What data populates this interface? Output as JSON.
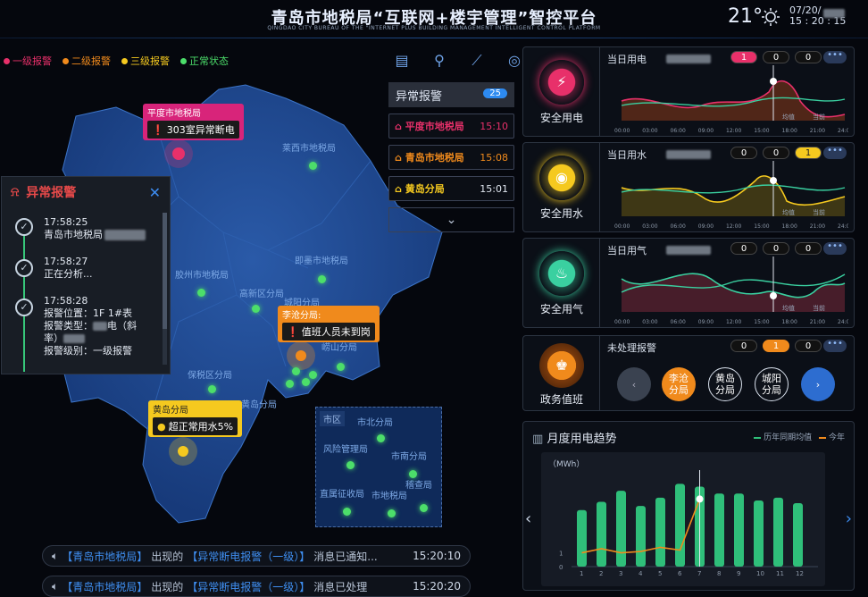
{
  "header": {
    "title": "青岛市地税局“互联网+楼宇管理”智控平台",
    "subtitle": "QINGDAO CITY BUREAU OF THE \"INTERNET PLUS BUILDING MANAGEMENT INTELLIGENT CONTROL PLATFORM",
    "temperature": "21°",
    "date": "07/20/",
    "time": "15 : 20 : 15"
  },
  "legend": [
    {
      "label": "一级报警",
      "color": "#e8306a"
    },
    {
      "label": "二级报警",
      "color": "#f08a1c"
    },
    {
      "label": "三级报警",
      "color": "#f5c91f"
    },
    {
      "label": "正常状态",
      "color": "#4cde6a"
    }
  ],
  "map": {
    "labels": [
      "莱西市地税局",
      "胶州市地税局",
      "即墨市地税局",
      "高新区分局",
      "城阳分局",
      "崂山分局",
      "保税区分局",
      "黄岛分局"
    ],
    "inset_title": "市区",
    "inset_labels": [
      "市北分局",
      "风险管理局",
      "市南分局",
      "稽查局",
      "直属征收局",
      "市地税局"
    ],
    "callouts": [
      {
        "title": "平度市地税局",
        "message": "303室异常断电",
        "level": "一级"
      },
      {
        "title": "李沧分局:",
        "message": "值班人员未到岗",
        "level": "二级"
      },
      {
        "title": "黄岛分局",
        "message": "超正常用水5%",
        "level": "三级"
      }
    ]
  },
  "toolbar": {
    "icons": [
      "chart-icon",
      "person-pin-icon",
      "trend-icon",
      "camera-icon"
    ]
  },
  "abnormal": {
    "title": "异常报警",
    "count": "25",
    "items": [
      {
        "name": "平度市地税局",
        "time": "15:10",
        "color": "#e8306a"
      },
      {
        "name": "青岛市地税局",
        "time": "15:08",
        "color": "#f08a1c"
      },
      {
        "name": "黄岛分局",
        "time": "15:01",
        "color": "#f5c91f"
      }
    ]
  },
  "popup": {
    "title": "异常报警",
    "entries": [
      {
        "time": "17:58:25",
        "text": "青岛市地税局"
      },
      {
        "time": "17:58:27",
        "text": "正在分析..."
      },
      {
        "time": "17:58:28",
        "lines": [
          "报警位置：1F 1#表",
          "报警类型：",
          "电（斜",
          "率）",
          "报警级别：一级报警"
        ]
      }
    ]
  },
  "ticker": [
    {
      "bracket1": "【青岛市地税局】",
      "mid1": "出现的",
      "bracket2": "【异常断电报警（一级）】",
      "tail": "消息已通知...",
      "time": "15:20:10"
    },
    {
      "bracket1": "【青岛市地税局】",
      "mid1": "出现的",
      "bracket2": "【异常断电报警（一级）】",
      "tail": "消息已处理",
      "time": "15:20:20"
    }
  ],
  "cards": [
    {
      "label": "安全用电",
      "title": "当日用电",
      "pills": [
        "1",
        "0",
        "0"
      ],
      "ring_color": "#e8306a",
      "icon": "lightning-icon",
      "xticks": [
        "00:00",
        "03:00",
        "06:00",
        "09:00",
        "12:00",
        "15:00",
        "18:00",
        "21:00",
        "24:00"
      ],
      "legend": [
        "均值",
        "当前"
      ]
    },
    {
      "label": "安全用水",
      "title": "当日用水",
      "pills": [
        "0",
        "0",
        "1"
      ],
      "ring_color": "#f5c91f",
      "icon": "water-drop-icon",
      "xticks": [
        "00:00",
        "03:00",
        "06:00",
        "09:00",
        "12:00",
        "15:00",
        "18:00",
        "21:00",
        "24:00"
      ],
      "legend": [
        "均值",
        "当前"
      ]
    },
    {
      "label": "安全用气",
      "title": "当日用气",
      "pills": [
        "0",
        "0",
        "0"
      ],
      "ring_color": "#3ad0a0",
      "icon": "flame-icon",
      "xticks": [
        "00:00",
        "03:00",
        "06:00",
        "09:00",
        "12:00",
        "15:00",
        "18:00",
        "21:00",
        "24:00"
      ],
      "legend": [
        "均值",
        "当前"
      ]
    }
  ],
  "duty": {
    "label": "政务值班",
    "title": "未处理报警",
    "pills": [
      "0",
      "1",
      "0"
    ],
    "buttons": [
      "李沧\n分局",
      "黄岛\n分局",
      "城阳\n分局"
    ]
  },
  "trend": {
    "title": "月度用电趋势",
    "legend": [
      "历年同期均值",
      "今年"
    ],
    "unit": "（MWh）",
    "more": "•••"
  },
  "chart_data": {
    "type": "bar",
    "title": "月度用电趋势",
    "ylabel": "（MWh）",
    "categories": [
      "1",
      "2",
      "3",
      "4",
      "5",
      "6",
      "7",
      "8",
      "9",
      "10",
      "11",
      "12"
    ],
    "series": [
      {
        "name": "历年同期均值",
        "values": [
          4.1,
          4.7,
          5.5,
          4.4,
          5.0,
          6.0,
          5.8,
          5.3,
          5.3,
          4.8,
          5.0,
          4.6
        ]
      },
      {
        "name": "今年",
        "values": [
          1.0,
          1.3,
          1.0,
          1.1,
          1.4,
          1.2,
          4.9,
          null,
          null,
          null,
          null,
          null
        ]
      }
    ],
    "ylim": [
      0,
      7
    ]
  }
}
